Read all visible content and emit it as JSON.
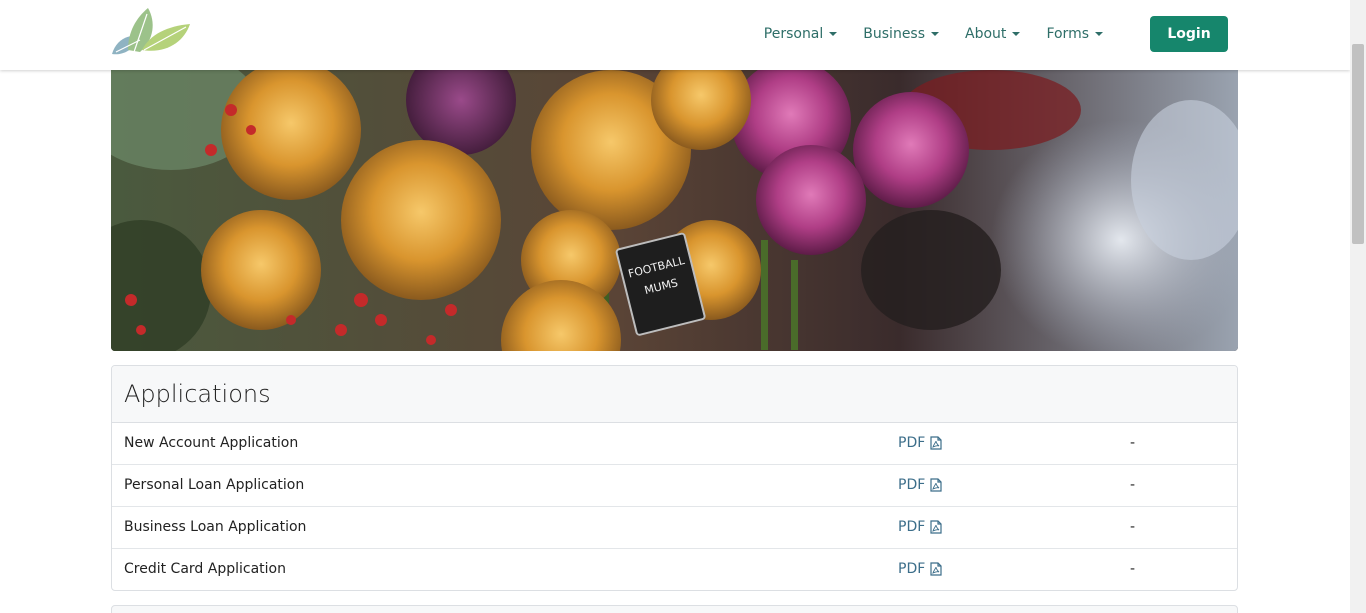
{
  "navbar": {
    "menu": [
      {
        "label": "Personal"
      },
      {
        "label": "Business"
      },
      {
        "label": "About"
      },
      {
        "label": "Forms"
      }
    ],
    "login_label": "Login",
    "accent_color": "#16866c",
    "link_color": "#2e6e68"
  },
  "hero": {
    "sign_text_line1": "FOOTBALL",
    "sign_text_line2": "MUMS"
  },
  "applications": {
    "title": "Applications",
    "rows": [
      {
        "name": "New Account Application",
        "link": "PDF",
        "icon": "file-pdf-icon",
        "extra": "-"
      },
      {
        "name": "Personal Loan Application",
        "link": "PDF",
        "icon": "file-pdf-icon",
        "extra": "-"
      },
      {
        "name": "Business Loan Application",
        "link": "PDF",
        "icon": "file-pdf-icon",
        "extra": "-"
      },
      {
        "name": "Credit Card Application",
        "link": "PDF",
        "icon": "file-pdf-icon",
        "extra": "-"
      }
    ]
  }
}
